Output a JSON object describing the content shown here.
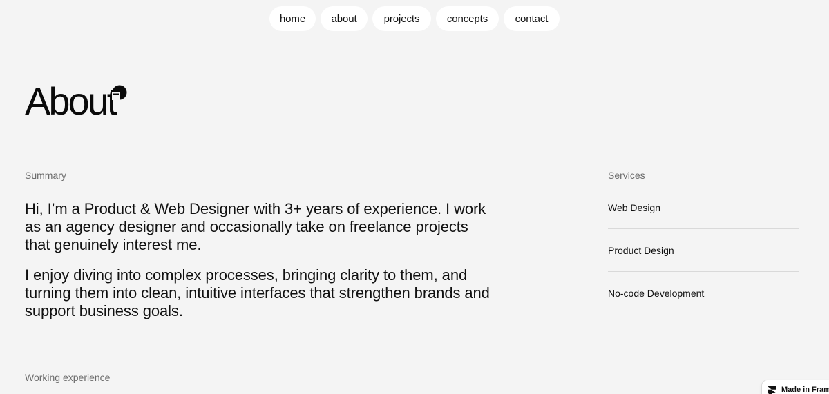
{
  "nav": {
    "items": [
      {
        "label": "home"
      },
      {
        "label": "about"
      },
      {
        "label": "projects"
      },
      {
        "label": "concepts"
      },
      {
        "label": "contact"
      }
    ]
  },
  "header": {
    "title": "About"
  },
  "summary": {
    "label": "Summary",
    "paragraphs": [
      "Hi, I’m a Product & Web Designer with 3+ years of experience. I work as an agency designer and occasionally take on freelance projects that genuinely interest me.",
      "I enjoy diving into complex processes, bringing clarity to them, and turning them into clean, intuitive interfaces that strengthen brands and support business goals."
    ]
  },
  "services": {
    "label": "Services",
    "items": [
      {
        "label": "Web Design"
      },
      {
        "label": "Product Design"
      },
      {
        "label": "No-code Development"
      }
    ]
  },
  "experience": {
    "label": "Working experience"
  },
  "badge": {
    "label": "Made in Framer"
  }
}
